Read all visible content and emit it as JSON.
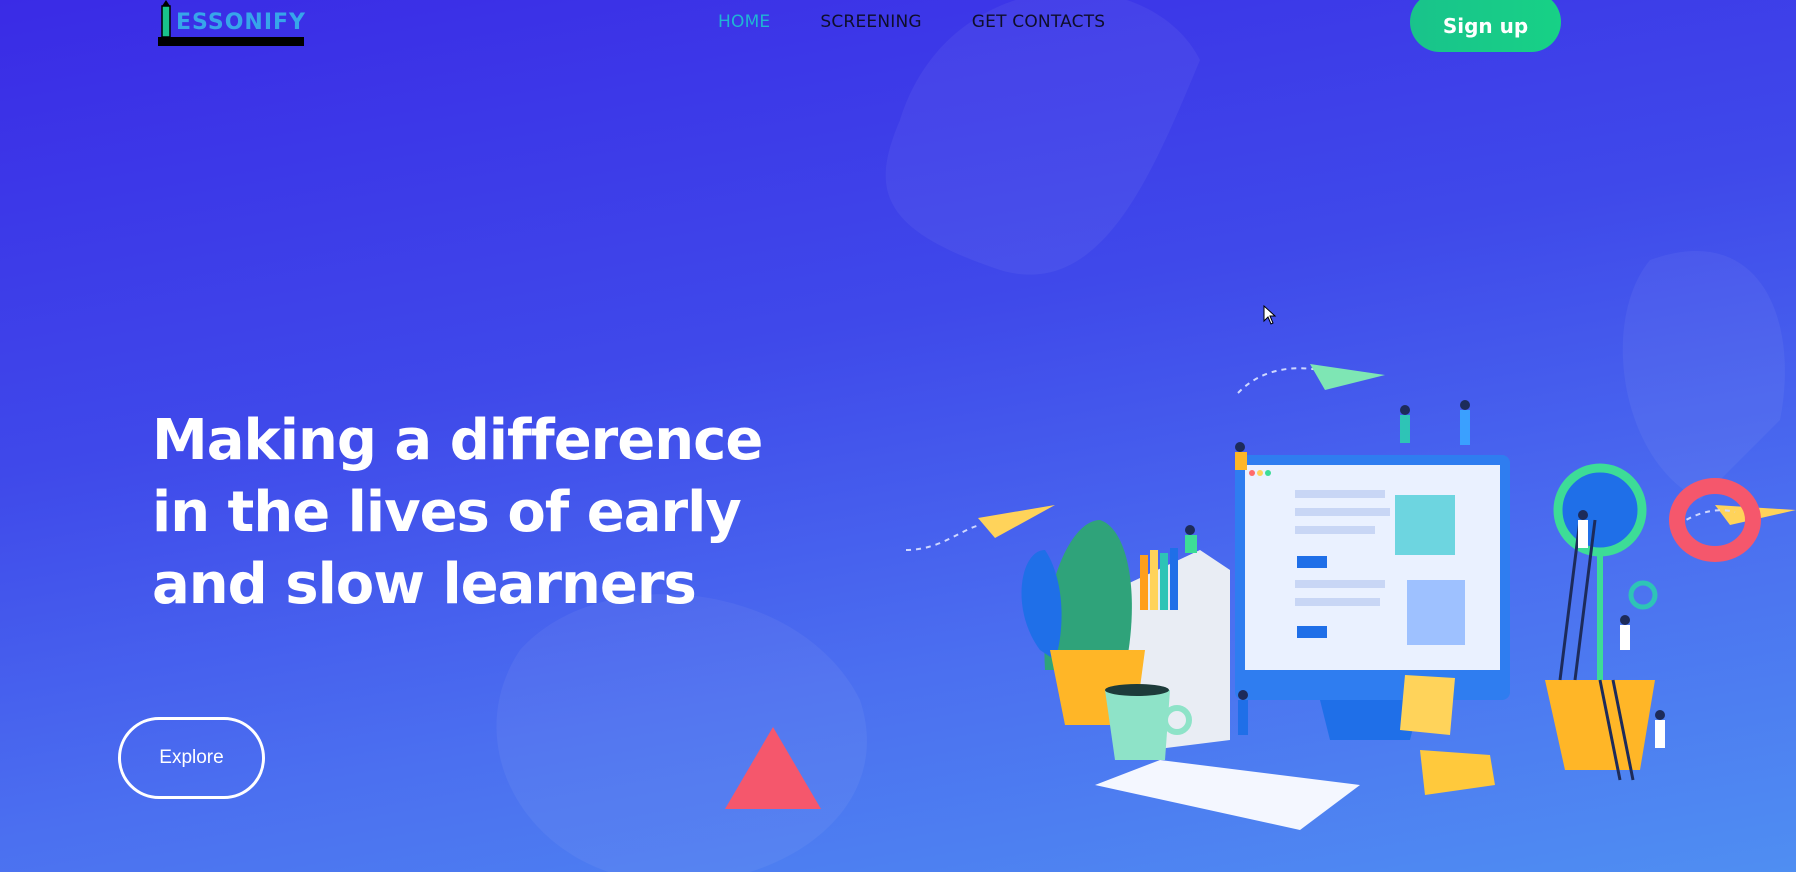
{
  "brand": {
    "name": "ESSONIFY"
  },
  "nav": {
    "items": [
      {
        "label": "HOME",
        "active": true
      },
      {
        "label": "SCREENING",
        "active": false
      },
      {
        "label": "GET CONTACTS",
        "active": false
      }
    ]
  },
  "header": {
    "signup_label": "Sign up"
  },
  "hero": {
    "title_line1": "Making a difference",
    "title_line2": "in the lives of early",
    "title_line3": "and slow learners",
    "explore_label": "Explore"
  },
  "colors": {
    "accent": "#1fb5d4",
    "signup": "#17c98a",
    "triangle": "#f5576c"
  }
}
